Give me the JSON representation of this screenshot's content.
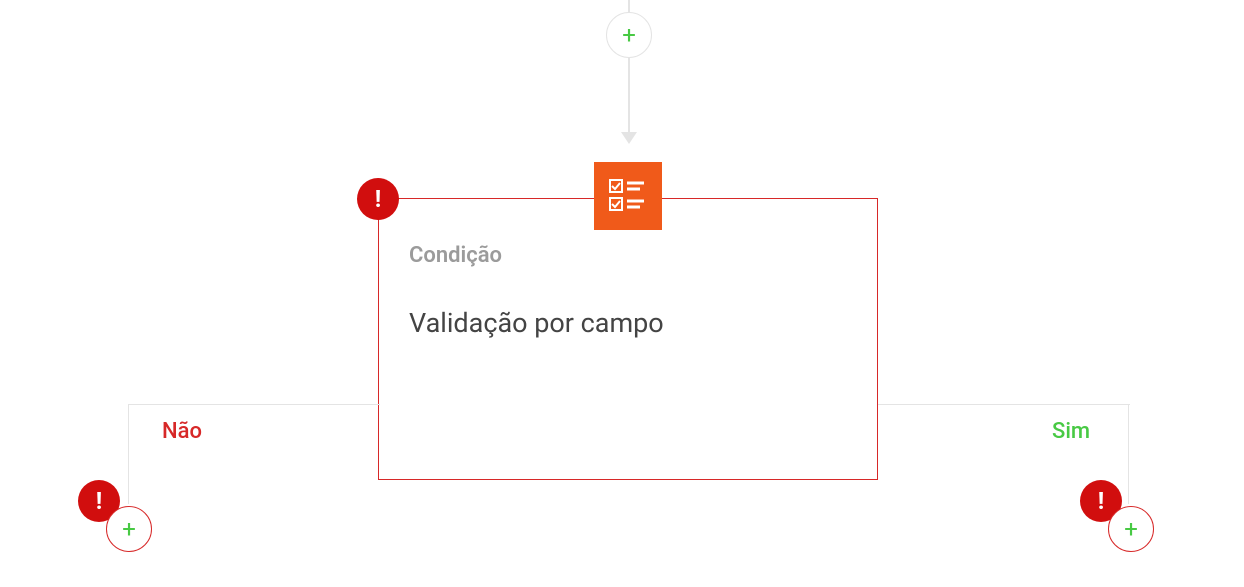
{
  "flow": {
    "condition_node": {
      "header": "Condição",
      "title": "Validação por campo",
      "has_error": true
    },
    "branches": {
      "no": {
        "label": "Não",
        "has_error": true
      },
      "yes": {
        "label": "Sim",
        "has_error": true
      }
    }
  },
  "glyphs": {
    "plus": "+",
    "exclaim": "!"
  },
  "colors": {
    "error": "#d10e0e",
    "card_border": "#d72828",
    "accent_green": "#48c944",
    "icon_orange": "#f05a1a"
  }
}
